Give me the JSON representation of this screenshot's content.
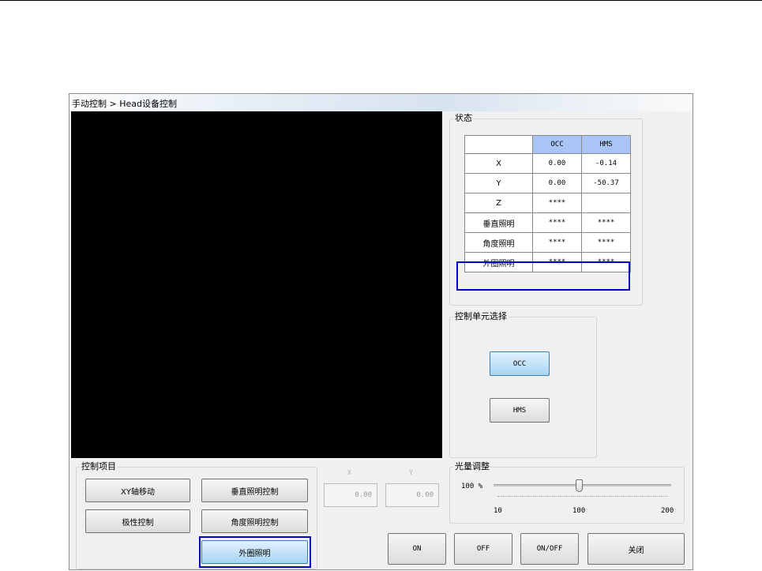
{
  "window": {
    "title": "手动控制 > Head设备控制"
  },
  "status_panel": {
    "legend": "状态",
    "columns": [
      "",
      "OCC",
      "HMS"
    ],
    "rows": [
      {
        "label": "X",
        "occ": "0.00",
        "hms": "-0.14"
      },
      {
        "label": "Y",
        "occ": "0.00",
        "hms": "-50.37"
      },
      {
        "label": "Z",
        "occ": "****",
        "hms": ""
      },
      {
        "label": "垂直照明",
        "occ": "****",
        "hms": "****"
      },
      {
        "label": "角度照明",
        "occ": "****",
        "hms": "****"
      },
      {
        "label": "外圈照明",
        "occ": "****",
        "hms": "****"
      }
    ]
  },
  "unit_select": {
    "legend": "控制单元选择",
    "occ_label": "OCC",
    "hms_label": "HMS",
    "selected": "OCC"
  },
  "control_items": {
    "legend": "控制项目",
    "xy_move": "XY轴移动",
    "vertical_light": "垂直照明控制",
    "polarity": "极性控制",
    "angle_light": "角度照明控制",
    "outer_ring": "外圈照明",
    "selected": "外圈照明"
  },
  "coords": {
    "x_label": "X",
    "y_label": "Y",
    "x_value": "0.00",
    "y_value": "0.00"
  },
  "light_adjust": {
    "legend": "光量调整",
    "value_text": "100 %",
    "value": 100,
    "min": 10,
    "max": 200,
    "min_label": "10",
    "mid_label": "100",
    "max_label": "200"
  },
  "bottom_buttons": {
    "on": "ON",
    "off": "OFF",
    "on_off": "ON/OFF",
    "close": "关闭"
  },
  "colors": {
    "highlight": "#0000c8",
    "header_blue": "#a9c5f5",
    "active_button": "#a7d4f4"
  }
}
